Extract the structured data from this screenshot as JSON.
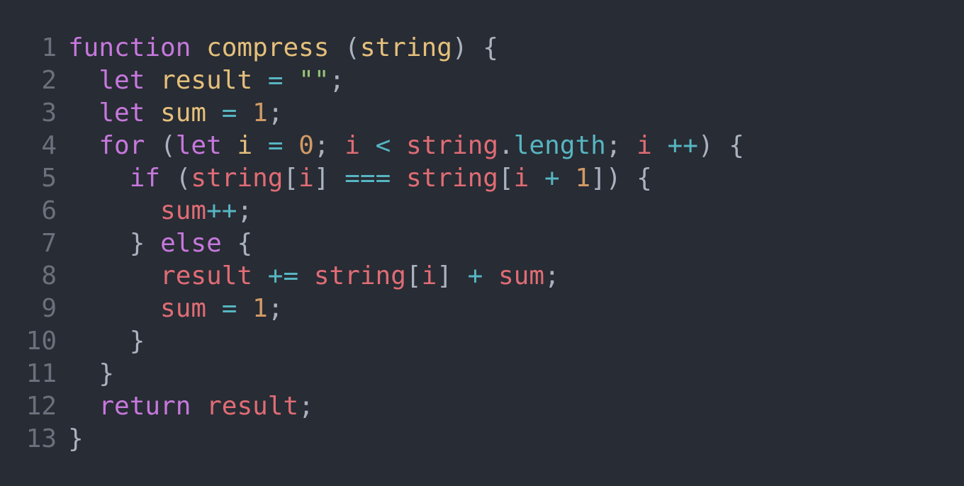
{
  "editor": {
    "language": "javascript",
    "theme_colors": {
      "background": "#282c34",
      "line_number": "#6b717c",
      "keyword": "#c678dd",
      "function": "#e5c07b",
      "variable": "#e06c75",
      "operator": "#56b6c2",
      "number": "#d19a66",
      "string": "#98c379",
      "punctuation": "#abb2bf"
    },
    "lines": [
      {
        "number": "1",
        "tokens": [
          {
            "text": "function",
            "type": "keyword"
          },
          {
            "text": " ",
            "type": "plain"
          },
          {
            "text": "compress",
            "type": "function"
          },
          {
            "text": " ",
            "type": "plain"
          },
          {
            "text": "(",
            "type": "punctuation"
          },
          {
            "text": "string",
            "type": "param"
          },
          {
            "text": ") {",
            "type": "punctuation"
          }
        ]
      },
      {
        "number": "2",
        "tokens": [
          {
            "text": "  ",
            "type": "plain"
          },
          {
            "text": "let",
            "type": "keyword"
          },
          {
            "text": " ",
            "type": "plain"
          },
          {
            "text": "result",
            "type": "param"
          },
          {
            "text": " ",
            "type": "plain"
          },
          {
            "text": "=",
            "type": "operator"
          },
          {
            "text": " ",
            "type": "plain"
          },
          {
            "text": "\"\"",
            "type": "string"
          },
          {
            "text": ";",
            "type": "punctuation"
          }
        ]
      },
      {
        "number": "3",
        "tokens": [
          {
            "text": "  ",
            "type": "plain"
          },
          {
            "text": "let",
            "type": "keyword"
          },
          {
            "text": " ",
            "type": "plain"
          },
          {
            "text": "sum",
            "type": "param"
          },
          {
            "text": " ",
            "type": "plain"
          },
          {
            "text": "=",
            "type": "operator"
          },
          {
            "text": " ",
            "type": "plain"
          },
          {
            "text": "1",
            "type": "number"
          },
          {
            "text": ";",
            "type": "punctuation"
          }
        ]
      },
      {
        "number": "4",
        "tokens": [
          {
            "text": "  ",
            "type": "plain"
          },
          {
            "text": "for",
            "type": "keyword"
          },
          {
            "text": " (",
            "type": "punctuation"
          },
          {
            "text": "let",
            "type": "keyword"
          },
          {
            "text": " ",
            "type": "plain"
          },
          {
            "text": "i",
            "type": "param"
          },
          {
            "text": " ",
            "type": "plain"
          },
          {
            "text": "=",
            "type": "operator"
          },
          {
            "text": " ",
            "type": "plain"
          },
          {
            "text": "0",
            "type": "number"
          },
          {
            "text": "; ",
            "type": "punctuation"
          },
          {
            "text": "i",
            "type": "variable"
          },
          {
            "text": " ",
            "type": "plain"
          },
          {
            "text": "<",
            "type": "operator"
          },
          {
            "text": " ",
            "type": "plain"
          },
          {
            "text": "string",
            "type": "variable"
          },
          {
            "text": ".",
            "type": "punctuation"
          },
          {
            "text": "length",
            "type": "property"
          },
          {
            "text": "; ",
            "type": "punctuation"
          },
          {
            "text": "i",
            "type": "variable"
          },
          {
            "text": " ",
            "type": "plain"
          },
          {
            "text": "++",
            "type": "operator"
          },
          {
            "text": ") {",
            "type": "punctuation"
          }
        ]
      },
      {
        "number": "5",
        "tokens": [
          {
            "text": "    ",
            "type": "plain"
          },
          {
            "text": "if",
            "type": "keyword"
          },
          {
            "text": " (",
            "type": "punctuation"
          },
          {
            "text": "string",
            "type": "variable"
          },
          {
            "text": "[",
            "type": "punctuation"
          },
          {
            "text": "i",
            "type": "variable"
          },
          {
            "text": "]",
            "type": "punctuation"
          },
          {
            "text": " ",
            "type": "plain"
          },
          {
            "text": "===",
            "type": "operator"
          },
          {
            "text": " ",
            "type": "plain"
          },
          {
            "text": "string",
            "type": "variable"
          },
          {
            "text": "[",
            "type": "punctuation"
          },
          {
            "text": "i",
            "type": "variable"
          },
          {
            "text": " ",
            "type": "plain"
          },
          {
            "text": "+",
            "type": "operator"
          },
          {
            "text": " ",
            "type": "plain"
          },
          {
            "text": "1",
            "type": "number"
          },
          {
            "text": "]) {",
            "type": "punctuation"
          }
        ]
      },
      {
        "number": "6",
        "tokens": [
          {
            "text": "      ",
            "type": "plain"
          },
          {
            "text": "sum",
            "type": "variable"
          },
          {
            "text": "++",
            "type": "operator"
          },
          {
            "text": ";",
            "type": "punctuation"
          }
        ]
      },
      {
        "number": "7",
        "tokens": [
          {
            "text": "    ",
            "type": "plain"
          },
          {
            "text": "} ",
            "type": "punctuation"
          },
          {
            "text": "else",
            "type": "keyword"
          },
          {
            "text": " {",
            "type": "punctuation"
          }
        ]
      },
      {
        "number": "8",
        "tokens": [
          {
            "text": "      ",
            "type": "plain"
          },
          {
            "text": "result",
            "type": "variable"
          },
          {
            "text": " ",
            "type": "plain"
          },
          {
            "text": "+=",
            "type": "operator"
          },
          {
            "text": " ",
            "type": "plain"
          },
          {
            "text": "string",
            "type": "variable"
          },
          {
            "text": "[",
            "type": "punctuation"
          },
          {
            "text": "i",
            "type": "variable"
          },
          {
            "text": "]",
            "type": "punctuation"
          },
          {
            "text": " ",
            "type": "plain"
          },
          {
            "text": "+",
            "type": "operator"
          },
          {
            "text": " ",
            "type": "plain"
          },
          {
            "text": "sum",
            "type": "variable"
          },
          {
            "text": ";",
            "type": "punctuation"
          }
        ]
      },
      {
        "number": "9",
        "tokens": [
          {
            "text": "      ",
            "type": "plain"
          },
          {
            "text": "sum",
            "type": "variable"
          },
          {
            "text": " ",
            "type": "plain"
          },
          {
            "text": "=",
            "type": "operator"
          },
          {
            "text": " ",
            "type": "plain"
          },
          {
            "text": "1",
            "type": "number"
          },
          {
            "text": ";",
            "type": "punctuation"
          }
        ]
      },
      {
        "number": "10",
        "tokens": [
          {
            "text": "    ",
            "type": "plain"
          },
          {
            "text": "}",
            "type": "punctuation"
          }
        ]
      },
      {
        "number": "11",
        "tokens": [
          {
            "text": "  ",
            "type": "plain"
          },
          {
            "text": "}",
            "type": "punctuation"
          }
        ]
      },
      {
        "number": "12",
        "tokens": [
          {
            "text": "  ",
            "type": "plain"
          },
          {
            "text": "return",
            "type": "keyword"
          },
          {
            "text": " ",
            "type": "plain"
          },
          {
            "text": "result",
            "type": "variable"
          },
          {
            "text": ";",
            "type": "punctuation"
          }
        ]
      },
      {
        "number": "13",
        "tokens": [
          {
            "text": "}",
            "type": "punctuation"
          }
        ]
      }
    ]
  }
}
